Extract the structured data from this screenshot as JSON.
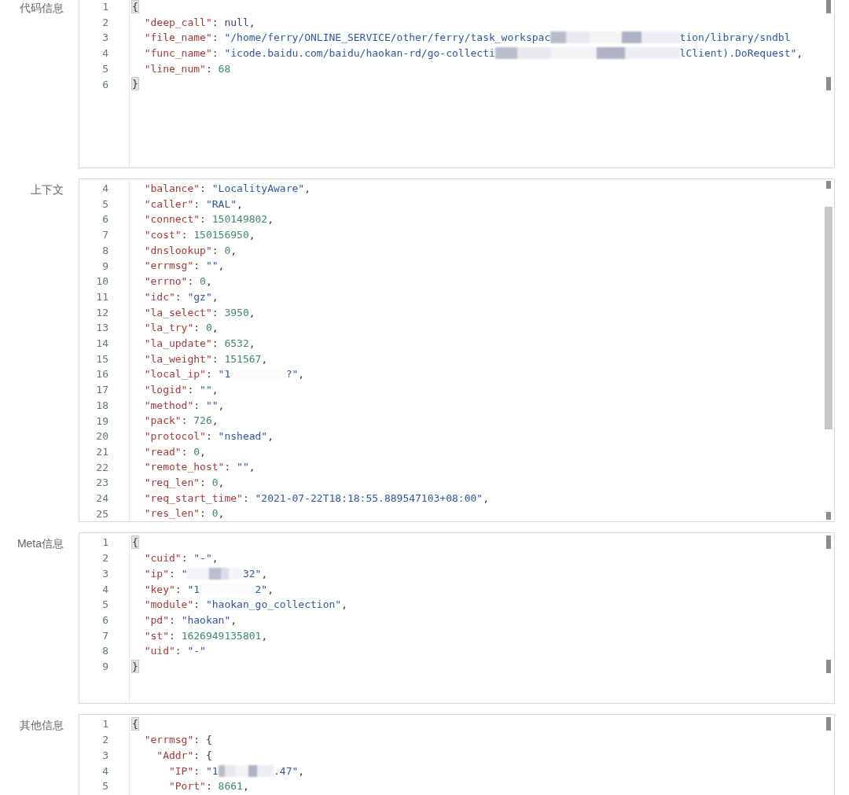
{
  "sections": [
    {
      "label": "代码信息",
      "scrolled": false,
      "lines": [
        {
          "number": "1",
          "tokens": [
            {
              "kind": "bracket",
              "text": "{",
              "matched": true
            }
          ]
        },
        {
          "number": "2",
          "tokens": [
            {
              "kind": "key",
              "text": "  \"deep_call\""
            },
            {
              "kind": "punct",
              "text": ": "
            },
            {
              "kind": "null",
              "text": "null"
            },
            {
              "kind": "punct",
              "text": ","
            }
          ]
        },
        {
          "number": "3",
          "tokens": [
            {
              "kind": "key",
              "text": "  \"file_name\""
            },
            {
              "kind": "punct",
              "text": ": "
            },
            {
              "kind": "string",
              "text": "\"/home/ferry/ONLINE_SERVICE/other/ferry/task_workspac"
            },
            {
              "kind": "blur"
            },
            {
              "kind": "blur"
            },
            {
              "kind": "blur"
            },
            {
              "kind": "blur"
            },
            {
              "kind": "blur"
            },
            {
              "kind": "blur"
            },
            {
              "kind": "blur"
            },
            {
              "kind": "string",
              "text": "tion/library/sndbl"
            }
          ]
        },
        {
          "number": "4",
          "tokens": [
            {
              "kind": "key",
              "text": "  \"func_name\""
            },
            {
              "kind": "punct",
              "text": ": "
            },
            {
              "kind": "string",
              "text": "\"icode.baidu.com/baidu/haokan-rd/go-collecti"
            },
            {
              "kind": "blur"
            },
            {
              "kind": "blur"
            },
            {
              "kind": "blur"
            },
            {
              "kind": "blur"
            },
            {
              "kind": "blur"
            },
            {
              "kind": "blur"
            },
            {
              "kind": "blur"
            },
            {
              "kind": "blur"
            },
            {
              "kind": "blur"
            },
            {
              "kind": "blur"
            },
            {
              "kind": "string",
              "text": "lClient).DoRequest\""
            },
            {
              "kind": "punct",
              "text": ","
            }
          ]
        },
        {
          "number": "5",
          "tokens": [
            {
              "kind": "key",
              "text": "  \"line_num\""
            },
            {
              "kind": "punct",
              "text": ": "
            },
            {
              "kind": "number",
              "text": "68"
            }
          ]
        },
        {
          "number": "6",
          "tokens": [
            {
              "kind": "bracket",
              "text": "}",
              "matched": true
            }
          ]
        }
      ]
    },
    {
      "label": "上下文",
      "scrolled": true,
      "lines": [
        {
          "number": "4",
          "tokens": [
            {
              "kind": "key",
              "text": "  \"balance\""
            },
            {
              "kind": "punct",
              "text": ": "
            },
            {
              "kind": "string",
              "text": "\"LocalityAware\""
            },
            {
              "kind": "punct",
              "text": ","
            }
          ]
        },
        {
          "number": "5",
          "tokens": [
            {
              "kind": "key",
              "text": "  \"caller\""
            },
            {
              "kind": "punct",
              "text": ": "
            },
            {
              "kind": "string",
              "text": "\"RAL\""
            },
            {
              "kind": "punct",
              "text": ","
            }
          ]
        },
        {
          "number": "6",
          "tokens": [
            {
              "kind": "key",
              "text": "  \"connect\""
            },
            {
              "kind": "punct",
              "text": ": "
            },
            {
              "kind": "number",
              "text": "150149802"
            },
            {
              "kind": "punct",
              "text": ","
            }
          ]
        },
        {
          "number": "7",
          "tokens": [
            {
              "kind": "key",
              "text": "  \"cost\""
            },
            {
              "kind": "punct",
              "text": ": "
            },
            {
              "kind": "number",
              "text": "150156950"
            },
            {
              "kind": "punct",
              "text": ","
            }
          ]
        },
        {
          "number": "8",
          "tokens": [
            {
              "kind": "key",
              "text": "  \"dnslookup\""
            },
            {
              "kind": "punct",
              "text": ": "
            },
            {
              "kind": "number",
              "text": "0"
            },
            {
              "kind": "punct",
              "text": ","
            }
          ]
        },
        {
          "number": "9",
          "tokens": [
            {
              "kind": "key",
              "text": "  \"errmsg\""
            },
            {
              "kind": "punct",
              "text": ": "
            },
            {
              "kind": "string",
              "text": "\"\""
            },
            {
              "kind": "punct",
              "text": ","
            }
          ]
        },
        {
          "number": "10",
          "tokens": [
            {
              "kind": "key",
              "text": "  \"errno\""
            },
            {
              "kind": "punct",
              "text": ": "
            },
            {
              "kind": "number",
              "text": "0"
            },
            {
              "kind": "punct",
              "text": ","
            }
          ]
        },
        {
          "number": "11",
          "tokens": [
            {
              "kind": "key",
              "text": "  \"idc\""
            },
            {
              "kind": "punct",
              "text": ": "
            },
            {
              "kind": "string",
              "text": "\"gz\""
            },
            {
              "kind": "punct",
              "text": ","
            }
          ]
        },
        {
          "number": "12",
          "tokens": [
            {
              "kind": "key",
              "text": "  \"la_select\""
            },
            {
              "kind": "punct",
              "text": ": "
            },
            {
              "kind": "number",
              "text": "3950"
            },
            {
              "kind": "punct",
              "text": ","
            }
          ]
        },
        {
          "number": "13",
          "tokens": [
            {
              "kind": "key",
              "text": "  \"la_try\""
            },
            {
              "kind": "punct",
              "text": ": "
            },
            {
              "kind": "number",
              "text": "0"
            },
            {
              "kind": "punct",
              "text": ","
            }
          ]
        },
        {
          "number": "14",
          "tokens": [
            {
              "kind": "key",
              "text": "  \"la_update\""
            },
            {
              "kind": "punct",
              "text": ": "
            },
            {
              "kind": "number",
              "text": "6532"
            },
            {
              "kind": "punct",
              "text": ","
            }
          ]
        },
        {
          "number": "15",
          "tokens": [
            {
              "kind": "key",
              "text": "  \"la_weight\""
            },
            {
              "kind": "punct",
              "text": ": "
            },
            {
              "kind": "number",
              "text": "151567"
            },
            {
              "kind": "punct",
              "text": ","
            }
          ]
        },
        {
          "number": "16",
          "tokens": [
            {
              "kind": "key",
              "text": "  \"local_ip\""
            },
            {
              "kind": "punct",
              "text": ": "
            },
            {
              "kind": "string",
              "text": "\"1"
            },
            {
              "kind": "blank"
            },
            {
              "kind": "blank"
            },
            {
              "kind": "blank"
            },
            {
              "kind": "string",
              "text": "?\""
            },
            {
              "kind": "punct",
              "text": ","
            }
          ]
        },
        {
          "number": "17",
          "tokens": [
            {
              "kind": "key",
              "text": "  \"logid\""
            },
            {
              "kind": "punct",
              "text": ": "
            },
            {
              "kind": "string",
              "text": "\"\""
            },
            {
              "kind": "punct",
              "text": ","
            }
          ]
        },
        {
          "number": "18",
          "tokens": [
            {
              "kind": "key",
              "text": "  \"method\""
            },
            {
              "kind": "punct",
              "text": ": "
            },
            {
              "kind": "string",
              "text": "\"\""
            },
            {
              "kind": "punct",
              "text": ","
            }
          ]
        },
        {
          "number": "19",
          "tokens": [
            {
              "kind": "key",
              "text": "  \"pack\""
            },
            {
              "kind": "punct",
              "text": ": "
            },
            {
              "kind": "number",
              "text": "726"
            },
            {
              "kind": "punct",
              "text": ","
            }
          ]
        },
        {
          "number": "20",
          "tokens": [
            {
              "kind": "key",
              "text": "  \"protocol\""
            },
            {
              "kind": "punct",
              "text": ": "
            },
            {
              "kind": "string",
              "text": "\"nshead\""
            },
            {
              "kind": "punct",
              "text": ","
            }
          ]
        },
        {
          "number": "21",
          "tokens": [
            {
              "kind": "key",
              "text": "  \"read\""
            },
            {
              "kind": "punct",
              "text": ": "
            },
            {
              "kind": "number",
              "text": "0"
            },
            {
              "kind": "punct",
              "text": ","
            }
          ]
        },
        {
          "number": "22",
          "tokens": [
            {
              "kind": "key",
              "text": "  \"remote_host\""
            },
            {
              "kind": "punct",
              "text": ": "
            },
            {
              "kind": "string",
              "text": "\"\""
            },
            {
              "kind": "punct",
              "text": ","
            }
          ]
        },
        {
          "number": "23",
          "tokens": [
            {
              "kind": "key",
              "text": "  \"req_len\""
            },
            {
              "kind": "punct",
              "text": ": "
            },
            {
              "kind": "number",
              "text": "0"
            },
            {
              "kind": "punct",
              "text": ","
            }
          ]
        },
        {
          "number": "24",
          "tokens": [
            {
              "kind": "key",
              "text": "  \"req_start_time\""
            },
            {
              "kind": "punct",
              "text": ": "
            },
            {
              "kind": "string",
              "text": "\"2021-07-22T18:18:55.889547103+08:00\""
            },
            {
              "kind": "punct",
              "text": ","
            }
          ]
        },
        {
          "number": "25",
          "tokens": [
            {
              "kind": "key",
              "text": "  \"res_len\""
            },
            {
              "kind": "punct",
              "text": ": "
            },
            {
              "kind": "number",
              "text": "0"
            },
            {
              "kind": "punct",
              "text": ","
            }
          ]
        }
      ]
    },
    {
      "label": "Meta信息",
      "scrolled": false,
      "lines": [
        {
          "number": "1",
          "tokens": [
            {
              "kind": "bracket",
              "text": "{",
              "matched": true
            }
          ]
        },
        {
          "number": "2",
          "tokens": [
            {
              "kind": "key",
              "text": "  \"cuid\""
            },
            {
              "kind": "punct",
              "text": ": "
            },
            {
              "kind": "string",
              "text": "\"-\""
            },
            {
              "kind": "punct",
              "text": ","
            }
          ]
        },
        {
          "number": "3",
          "tokens": [
            {
              "kind": "key",
              "text": "  \"ip\""
            },
            {
              "kind": "punct",
              "text": ": "
            },
            {
              "kind": "string",
              "text": "\""
            },
            {
              "kind": "haze"
            },
            {
              "kind": "haze"
            },
            {
              "kind": "haze"
            },
            {
              "kind": "string",
              "text": "32\""
            },
            {
              "kind": "punct",
              "text": ","
            }
          ]
        },
        {
          "number": "4",
          "tokens": [
            {
              "kind": "key",
              "text": "  \"key\""
            },
            {
              "kind": "punct",
              "text": ": "
            },
            {
              "kind": "string",
              "text": "\"1"
            },
            {
              "kind": "blank"
            },
            {
              "kind": "blank"
            },
            {
              "kind": "blank"
            },
            {
              "kind": "string",
              "text": "2\""
            },
            {
              "kind": "punct",
              "text": ","
            }
          ]
        },
        {
          "number": "5",
          "tokens": [
            {
              "kind": "key",
              "text": "  \"module\""
            },
            {
              "kind": "punct",
              "text": ": "
            },
            {
              "kind": "string",
              "text": "\"haokan_go_collection\""
            },
            {
              "kind": "punct",
              "text": ","
            }
          ]
        },
        {
          "number": "6",
          "tokens": [
            {
              "kind": "key",
              "text": "  \"pd\""
            },
            {
              "kind": "punct",
              "text": ": "
            },
            {
              "kind": "string",
              "text": "\"haokan\""
            },
            {
              "kind": "punct",
              "text": ","
            }
          ]
        },
        {
          "number": "7",
          "tokens": [
            {
              "kind": "key",
              "text": "  \"st\""
            },
            {
              "kind": "punct",
              "text": ": "
            },
            {
              "kind": "number",
              "text": "1626949135801"
            },
            {
              "kind": "punct",
              "text": ","
            }
          ]
        },
        {
          "number": "8",
          "tokens": [
            {
              "kind": "key",
              "text": "  \"uid\""
            },
            {
              "kind": "punct",
              "text": ": "
            },
            {
              "kind": "string",
              "text": "\"-\""
            }
          ]
        },
        {
          "number": "9",
          "tokens": [
            {
              "kind": "bracket",
              "text": "}",
              "matched": true
            }
          ]
        }
      ]
    },
    {
      "label": "其他信息",
      "scrolled": false,
      "lines": [
        {
          "number": "1",
          "tokens": [
            {
              "kind": "bracket",
              "text": "{",
              "matched": true
            }
          ]
        },
        {
          "number": "2",
          "tokens": [
            {
              "kind": "key",
              "text": "  \"errmsg\""
            },
            {
              "kind": "punct",
              "text": ": {"
            }
          ]
        },
        {
          "number": "3",
          "tokens": [
            {
              "kind": "key",
              "text": "    \"Addr\""
            },
            {
              "kind": "punct",
              "text": ": {"
            }
          ]
        },
        {
          "number": "4",
          "tokens": [
            {
              "kind": "key",
              "text": "      \"IP\""
            },
            {
              "kind": "punct",
              "text": ": "
            },
            {
              "kind": "string",
              "text": "\"1"
            },
            {
              "kind": "blur"
            },
            {
              "kind": "blur"
            },
            {
              "kind": "blur"
            },
            {
              "kind": "string",
              "text": ".47\""
            },
            {
              "kind": "punct",
              "text": ","
            }
          ]
        },
        {
          "number": "5",
          "tokens": [
            {
              "kind": "key",
              "text": "      \"Port\""
            },
            {
              "kind": "punct",
              "text": ": "
            },
            {
              "kind": "number",
              "text": "8661"
            },
            {
              "kind": "punct",
              "text": ","
            }
          ]
        }
      ]
    }
  ]
}
